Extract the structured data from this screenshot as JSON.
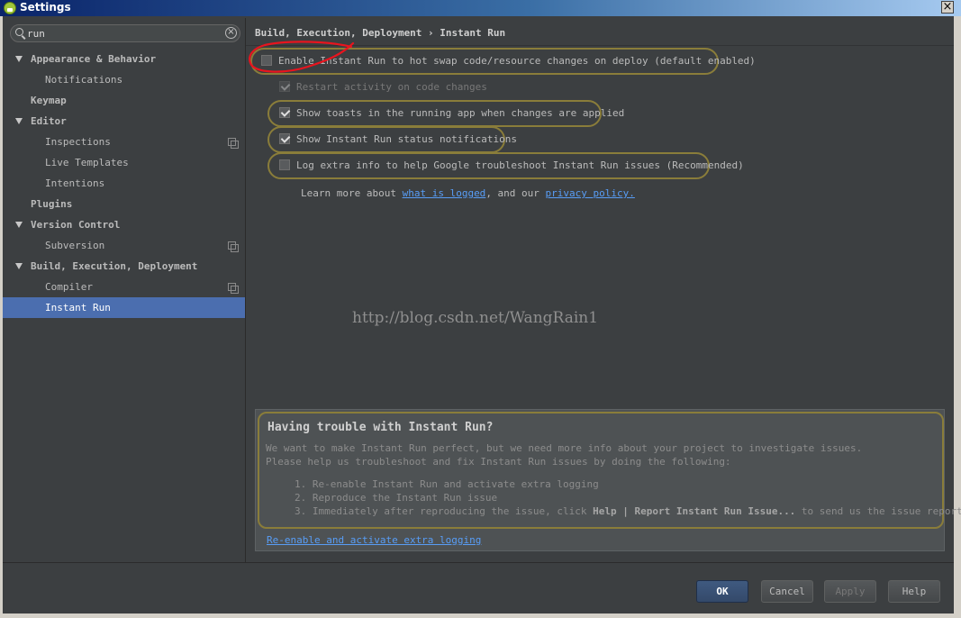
{
  "window": {
    "title": "Settings",
    "close_glyph": "×"
  },
  "search": {
    "value": "run",
    "clear_glyph": "×"
  },
  "tree": [
    {
      "label": "Appearance & Behavior"
    },
    {
      "label": "Notifications"
    },
    {
      "label": "Keymap"
    },
    {
      "label": "Editor"
    },
    {
      "label": "Inspections"
    },
    {
      "label": "Live Templates"
    },
    {
      "label": "Intentions"
    },
    {
      "label": "Plugins"
    },
    {
      "label": "Version Control"
    },
    {
      "label": "Subversion"
    },
    {
      "label": "Build, Execution, Deployment"
    },
    {
      "label": "Compiler"
    },
    {
      "label": "Instant Run"
    }
  ],
  "breadcrumb": "Build, Execution, Deployment › Instant Run",
  "options": {
    "enable": {
      "label": "Enable Instant Run to hot swap code/resource changes on deploy (default enabled)",
      "checked": false
    },
    "restart": {
      "label": "Restart activity on code changes",
      "checked": true,
      "enabled": false
    },
    "toasts": {
      "label": "Show toasts in the running app when changes are applied",
      "checked": true
    },
    "status": {
      "label": "Show Instant Run status notifications",
      "checked": true
    },
    "log": {
      "label": "Log extra info to help Google troubleshoot Instant Run issues (Recommended)",
      "checked": false
    }
  },
  "learn_more": {
    "prefix": "Learn more about ",
    "link1": "what is logged",
    "middle": ", and our ",
    "link2": "privacy policy."
  },
  "watermark": "http://blog.csdn.net/WangRain1",
  "trouble": {
    "title": "Having trouble with Instant Run?",
    "line1": "We want to make Instant Run perfect, but we need more info about your project to investigate issues.",
    "line2": "Please help us troubleshoot and fix Instant Run issues by doing the following:",
    "step1": "1. Re-enable Instant Run and activate extra logging",
    "step2": "2. Reproduce the Instant Run issue",
    "step3_prefix": "3. Immediately after reproducing the issue, click ",
    "step3_bold": "Help | Report Instant Run Issue...",
    "step3_suffix": " to send us the issue report.",
    "link": "Re-enable and activate extra logging"
  },
  "buttons": {
    "ok": "OK",
    "cancel": "Cancel",
    "apply": "Apply",
    "help": "Help"
  },
  "colors": {
    "selection": "#4b6eaf",
    "annotation_border": "#8a7d3a",
    "link": "#589df6",
    "red_annotation": "#e8141e"
  }
}
